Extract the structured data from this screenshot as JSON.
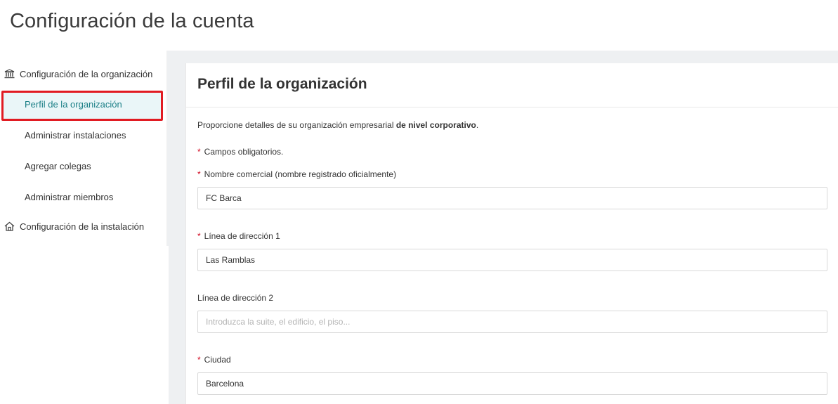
{
  "page": {
    "title": "Configuración de la cuenta"
  },
  "sidebar": {
    "groups": [
      {
        "label": "Configuración de la organización",
        "icon": "bank-icon"
      },
      {
        "label": "Configuración de la instalación",
        "icon": "home-icon"
      }
    ],
    "items": [
      {
        "label": "Perfil de la organización",
        "active": true
      },
      {
        "label": "Administrar instalaciones"
      },
      {
        "label": "Agregar colegas"
      },
      {
        "label": "Administrar miembros"
      }
    ]
  },
  "card": {
    "title": "Perfil de la organización",
    "intro_prefix": "Proporcione detalles de su organización empresarial ",
    "intro_bold": "de nivel corporativo",
    "intro_suffix": ".",
    "required_marker": "*",
    "required_note": "Campos obligatorios."
  },
  "fields": [
    {
      "label": "Nombre comercial (nombre registrado oficialmente)",
      "required": true,
      "value": "FC Barca",
      "placeholder": ""
    },
    {
      "label": "Línea de dirección 1",
      "required": true,
      "value": "Las Ramblas",
      "placeholder": ""
    },
    {
      "label": "Línea de dirección 2",
      "required": false,
      "value": "",
      "placeholder": "Introduzca la suite, el edificio, el piso..."
    },
    {
      "label": "Ciudad",
      "required": true,
      "value": "Barcelona",
      "placeholder": ""
    }
  ],
  "colors": {
    "accent": "#1b7f86",
    "highlight_border": "#e11b22",
    "required": "#d0021b",
    "background": "#eef0f2"
  }
}
